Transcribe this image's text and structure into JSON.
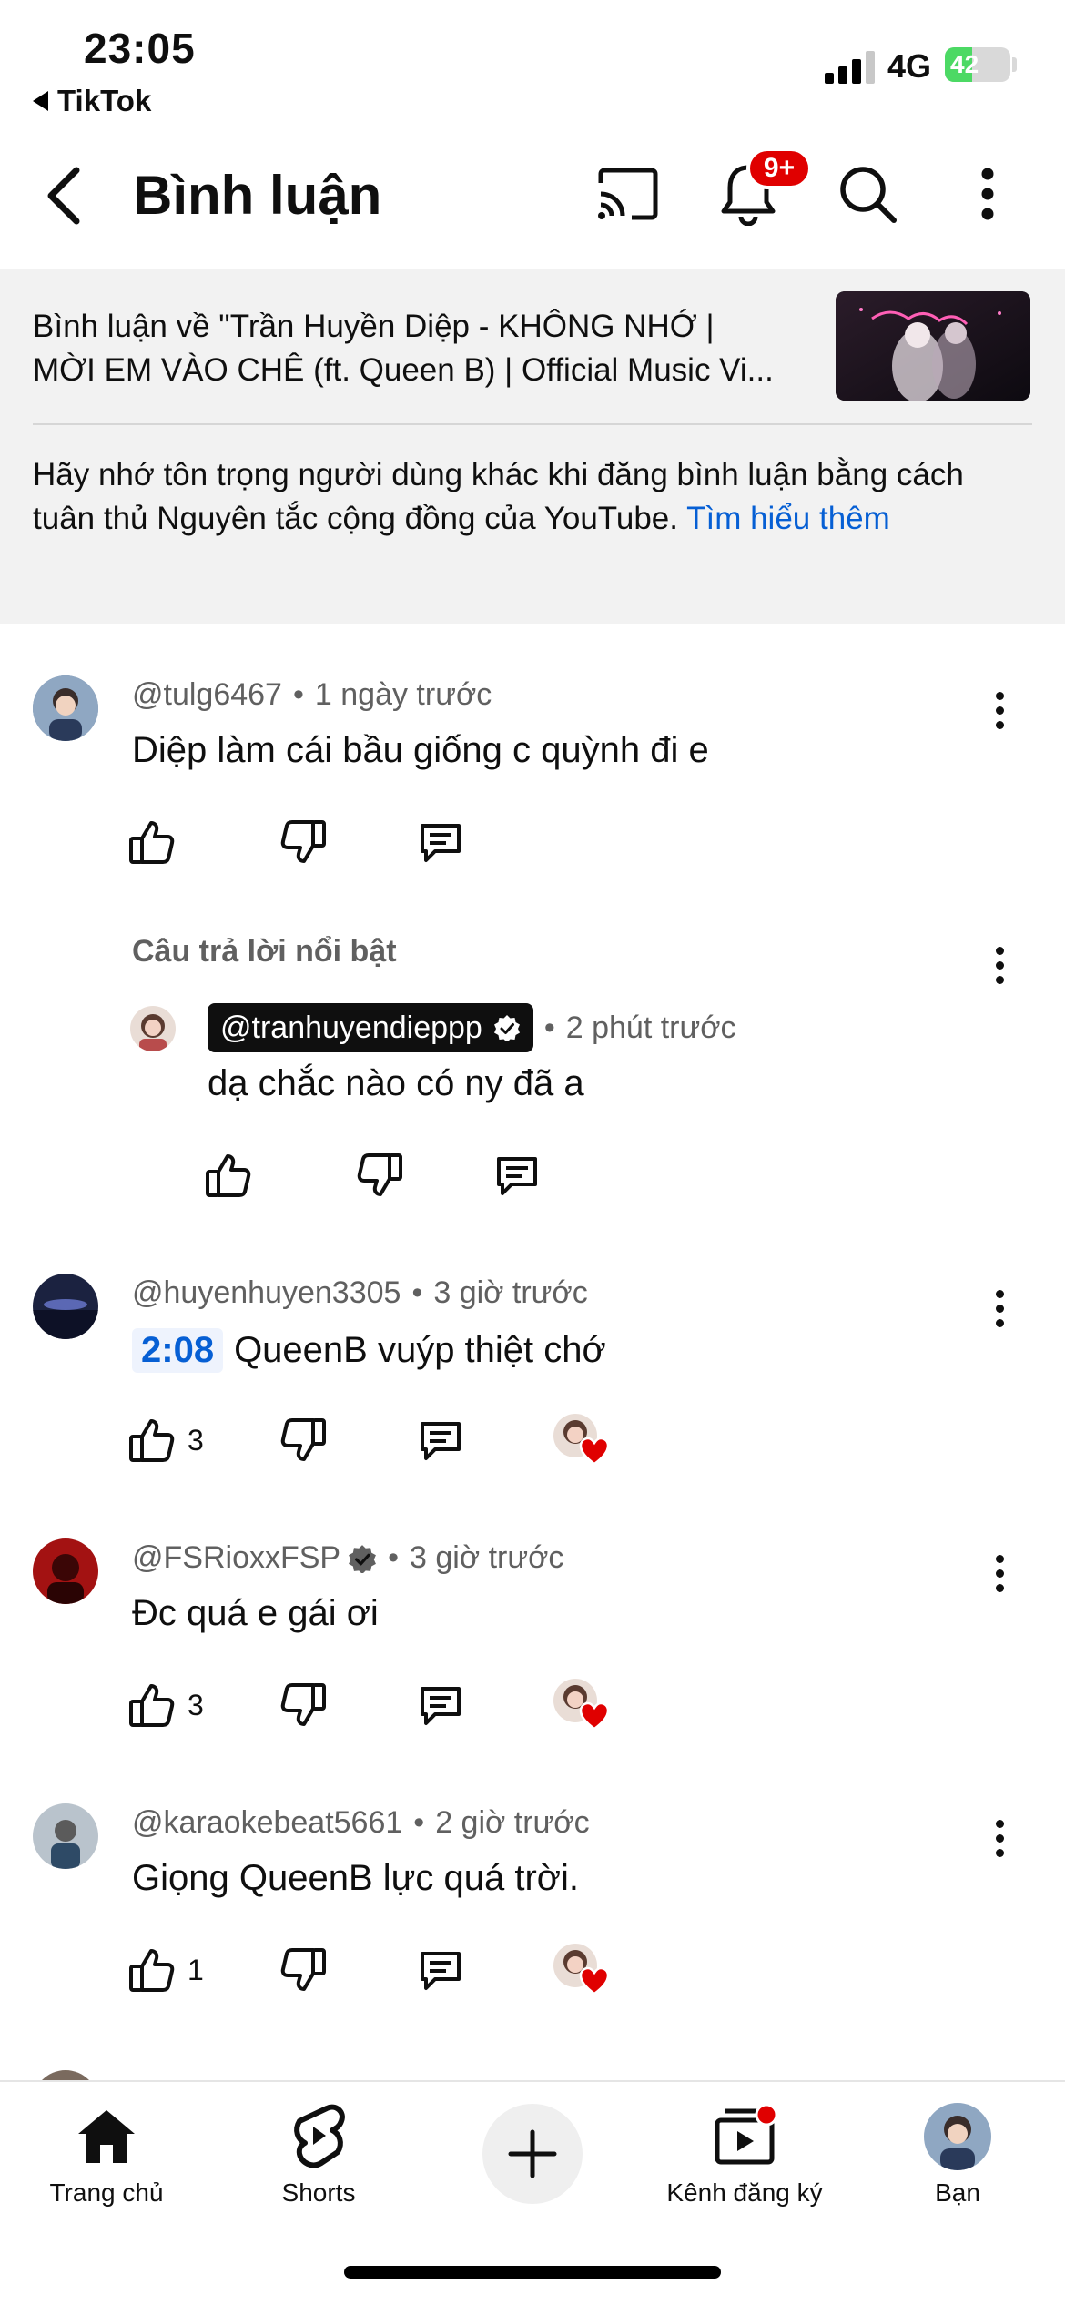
{
  "status_bar": {
    "time": "23:05",
    "back_app": "TikTok",
    "network": "4G",
    "battery": "42",
    "battery_level": 0.42,
    "battery_color": "#4cd964"
  },
  "header": {
    "title": "Bình luận",
    "notification_badge": "9+",
    "icons": [
      "back-arrow-icon",
      "cast-icon",
      "bell-icon",
      "search-icon",
      "more-vert-icon"
    ]
  },
  "video": {
    "title_line1": "Bình luận về \"Trần Huyền Diệp - KHÔNG NHỚ |",
    "title_line2": "MỜI EM VÀO CHÊ (ft. Queen B) | Official Music Vi...",
    "guideline_text": "Hãy nhớ tôn trọng người dùng khác khi đăng bình luận bằng cách tuân thủ Nguyên tắc cộng đồng của YouTube. ",
    "guideline_link": "Tìm hiểu thêm"
  },
  "comments": [
    {
      "author": "@tulg6467",
      "time": "1 ngày trước",
      "text": "Diệp làm cái bầu giống c quỳnh đi e",
      "likes": "",
      "featured_reply": {
        "label": "Câu trả lời nổi bật",
        "author": "@tranhuyendieppp",
        "time": "2 phút trước",
        "text": "dạ chắc nào có ny đã a"
      }
    },
    {
      "author": "@huyenhuyen3305",
      "time": "3 giờ trước",
      "timestamp": "2:08",
      "text": "QueenB vuýp thiệt chớ",
      "likes": "3",
      "creator_heart": true
    },
    {
      "author": "@FSRioxxFSP",
      "verified": true,
      "time": "3 giờ trước",
      "text": "Đc quá e gái ơi",
      "likes": "3",
      "creator_heart": true
    },
    {
      "author": "@karaokebeat5661",
      "time": "2 giờ trước",
      "text": "Giọng QueenB lực quá trời.",
      "likes": "1",
      "creator_heart": true
    }
  ],
  "bottom_nav": {
    "items": [
      {
        "label": "Trang chủ",
        "icon": "home-icon"
      },
      {
        "label": "Shorts",
        "icon": "shorts-icon"
      },
      {
        "label": "",
        "icon": "create-plus-icon"
      },
      {
        "label": "Kênh đăng ký",
        "icon": "subscriptions-icon"
      },
      {
        "label": "Bạn",
        "icon": "profile-avatar"
      }
    ]
  },
  "colors": {
    "link_blue": "#065fd4",
    "badge_red": "#e00000",
    "info_bg": "#f2f2f2",
    "meta_gray": "#606060"
  }
}
